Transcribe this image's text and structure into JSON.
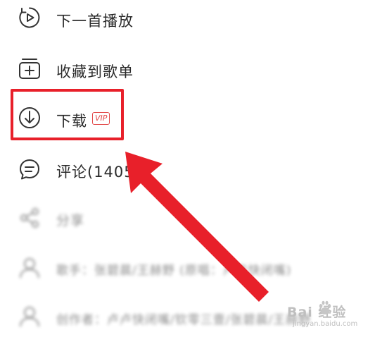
{
  "menu": {
    "items": [
      {
        "label": "下一首播放",
        "icon": "play-next-icon"
      },
      {
        "label": "收藏到歌单",
        "icon": "add-to-playlist-icon"
      },
      {
        "label": "下载",
        "icon": "download-icon",
        "badge": "VIP"
      },
      {
        "label": "评论(14058",
        "icon": "comment-icon"
      },
      {
        "label": "分享",
        "icon": "share-icon"
      },
      {
        "label": "歌手：张碧晨/王赫野 (原唱：卢卢快闭嘴)",
        "icon": "singer-icon"
      },
      {
        "label": "创作者：卢卢快闭嘴/钦零三壹/张碧晨/王赫野",
        "icon": "creator-icon"
      }
    ]
  },
  "watermark": {
    "brand": "Bai 经验",
    "sub": "jingyan.baidu.com"
  },
  "colors": {
    "highlight": "#e8202a",
    "vip": "#e24a4a",
    "text": "#2b2b2b"
  }
}
